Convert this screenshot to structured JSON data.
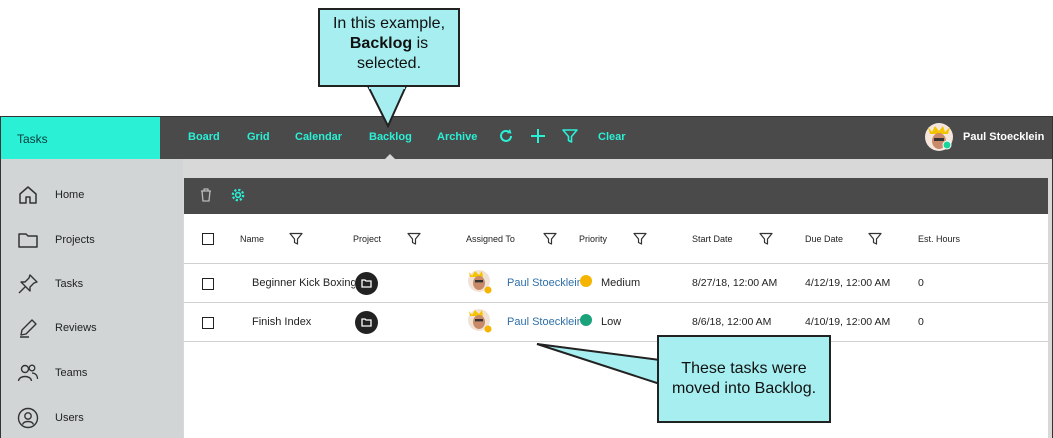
{
  "callouts": {
    "top": {
      "line1": "In this example,",
      "bold": "Backlog",
      "line2_rest": " is",
      "line3": "selected."
    },
    "bottom": {
      "line1": "These tasks were",
      "line2": "moved into Backlog."
    }
  },
  "topbar": {
    "brand": "Tasks",
    "nav": [
      "Board",
      "Grid",
      "Calendar",
      "Backlog",
      "Archive"
    ],
    "active": "Backlog",
    "clear_label": "Clear",
    "user_name": "Paul Stoecklein",
    "icons": [
      "refresh-icon",
      "plus-icon",
      "filter-icon"
    ]
  },
  "sidebar": {
    "items": [
      {
        "label": "Home",
        "icon": "home-icon"
      },
      {
        "label": "Projects",
        "icon": "folder-icon"
      },
      {
        "label": "Tasks",
        "icon": "pin-icon"
      },
      {
        "label": "Reviews",
        "icon": "pen-icon"
      },
      {
        "label": "Teams",
        "icon": "people-icon"
      },
      {
        "label": "Users",
        "icon": "user-icon"
      }
    ]
  },
  "table": {
    "toolbar_icons": [
      "trash-icon",
      "settings-gear-icon"
    ],
    "headers": {
      "name": "Name",
      "project": "Project",
      "assigned_to": "Assigned To",
      "priority": "Priority",
      "start_date": "Start Date",
      "due_date": "Due Date",
      "est_hours": "Est. Hours"
    },
    "rows": [
      {
        "name": "Beginner Kick Boxing",
        "assigned_to": "Paul Stoecklein",
        "priority": "Medium",
        "priority_color": "#f5b400",
        "start_date": "8/27/18, 12:00 AM",
        "due_date": "4/12/19, 12:00 AM",
        "est_hours": "0"
      },
      {
        "name": "Finish Index",
        "assigned_to": "Paul Stoecklein",
        "priority": "Low",
        "priority_color": "#1aa37a",
        "start_date": "8/6/18, 12:00 AM",
        "due_date": "4/10/19, 12:00 AM",
        "est_hours": "0"
      }
    ]
  },
  "colors": {
    "accent": "#2af0d6",
    "topbar": "#4a4a4a",
    "sidebar": "#d1d5d6",
    "callout": "#a6eef0",
    "link": "#2f6fa8"
  }
}
